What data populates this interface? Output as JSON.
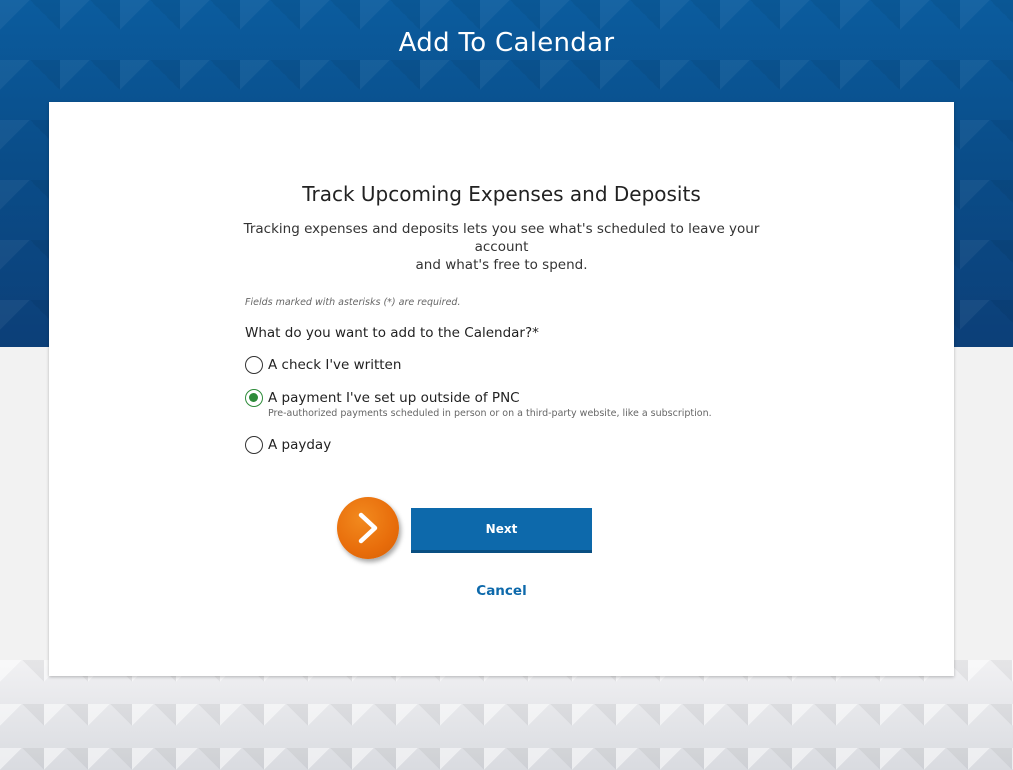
{
  "header": {
    "title": "Add To Calendar"
  },
  "card": {
    "title": "Track Upcoming Expenses and Deposits",
    "description_line1": "Tracking expenses and deposits lets you see what's scheduled to leave your account",
    "description_line2": "and what's free to spend.",
    "fields_note": "Fields marked with asterisks (*) are required.",
    "question": "What do you want to add to the Calendar?*",
    "options": [
      {
        "label": "A check I've written",
        "selected": false
      },
      {
        "label": "A payment I've set up outside of PNC",
        "sub": "Pre-authorized payments scheduled in person or on a third-party website, like a subscription.",
        "selected": true
      },
      {
        "label": "A payday",
        "selected": false
      }
    ],
    "next_label": "Next",
    "cancel_label": "Cancel"
  },
  "colors": {
    "header_blue": "#0a4d89",
    "button_blue": "#0d69ab",
    "badge_orange": "#e86d0b",
    "selected_green": "#2e8b3a"
  },
  "icons": {
    "step_badge": "chevron-right-icon"
  }
}
